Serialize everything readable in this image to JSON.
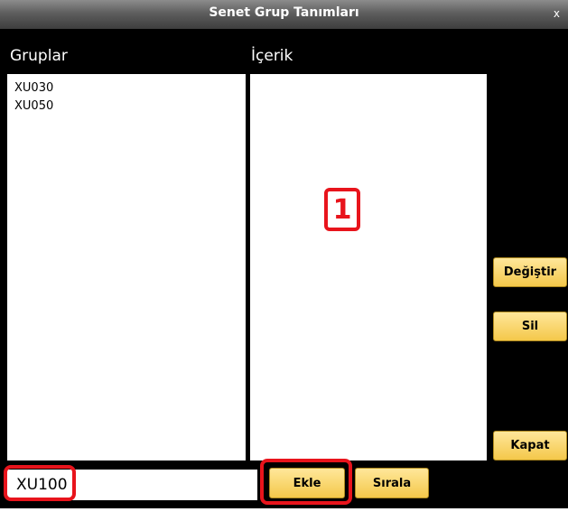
{
  "window": {
    "title": "Senet Grup Tanımları",
    "close_label": "x"
  },
  "groups": {
    "label": "Gruplar",
    "items": [
      "XU030",
      "XU050"
    ]
  },
  "content": {
    "label": "İçerik",
    "items": []
  },
  "buttons": {
    "change": "Değiştir",
    "delete": "Sil",
    "close": "Kapat",
    "add": "Ekle",
    "sort": "Sırala"
  },
  "input": {
    "value": "XU100"
  },
  "annotation": {
    "number": "1"
  },
  "colors": {
    "accent": "#e8141c",
    "button": "#f4c84a"
  }
}
